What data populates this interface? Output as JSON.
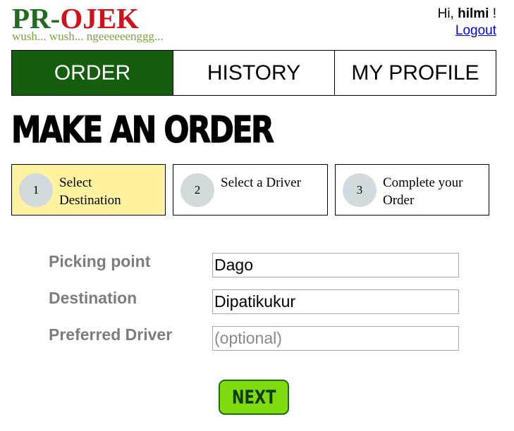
{
  "header": {
    "logo_left": "PR-",
    "logo_right": "OJEK",
    "tagline": "wush... wush... ngeeeeeenggg...",
    "greeting_prefix": "Hi, ",
    "username": "hilmi",
    "greeting_suffix": " !",
    "logout_label": "Logout"
  },
  "nav": {
    "tabs": [
      {
        "label": "ORDER",
        "active": true
      },
      {
        "label": "HISTORY",
        "active": false
      },
      {
        "label": "MY PROFILE",
        "active": false
      }
    ]
  },
  "page": {
    "title": "MAKE AN ORDER"
  },
  "steps": [
    {
      "number": "1",
      "label_line1": "Select",
      "label_line2": "Destination",
      "active": true
    },
    {
      "number": "2",
      "label_line1": "Select a Driver",
      "label_line2": "",
      "active": false
    },
    {
      "number": "3",
      "label_line1": "Complete your",
      "label_line2": "Order",
      "active": false
    }
  ],
  "form": {
    "picking_point_label": "Picking point",
    "picking_point_value": "Dago",
    "destination_label": "Destination",
    "destination_value": "Dipatikukur",
    "preferred_driver_label": "Preferred Driver",
    "preferred_driver_value": "",
    "preferred_driver_placeholder": "(optional)"
  },
  "actions": {
    "next_label": "NEXT"
  },
  "colors": {
    "logo_green": "#1f6b1f",
    "logo_red": "#d0131a",
    "tagline": "#7aa33b",
    "active_tab": "#145e0e",
    "active_step": "#fff3a0",
    "step_circle": "#d3dadd",
    "label_gray": "#7d7d7d",
    "next_button": "#7fdb0b"
  }
}
